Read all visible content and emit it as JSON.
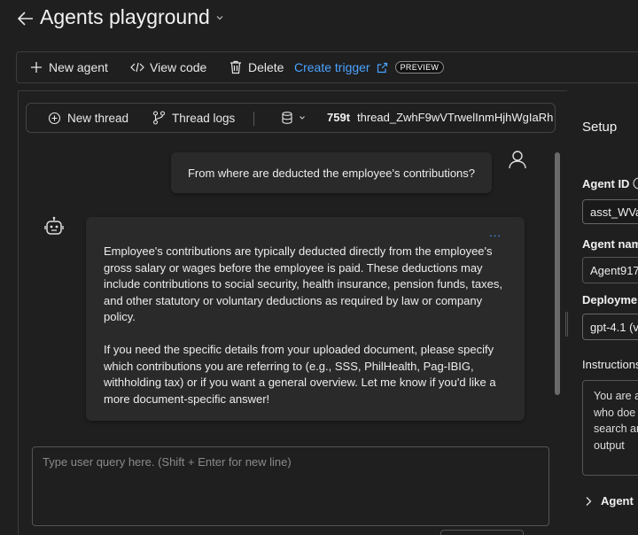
{
  "header": {
    "title": "Agents playground"
  },
  "toolbar": {
    "new_agent": "New agent",
    "view_code": "View code",
    "delete": "Delete",
    "create_trigger": "Create trigger",
    "preview_badge": "PREVIEW"
  },
  "thread_bar": {
    "new_thread": "New thread",
    "thread_logs": "Thread logs",
    "token_count": "759t",
    "thread_id": "thread_ZwhF9wVTrwelInmHjhWgIaRh"
  },
  "chat": {
    "user_message": "From where are deducted the employee's contributions?",
    "agent_message_p1": "Employee's contributions are typically deducted directly from the employee's gross salary or wages before the employee is paid. These deductions may include contributions to social security, health insurance, pension funds, taxes, and other statutory or voluntary deductions as required by law or company policy.",
    "agent_message_p2": "If you need the specific details from your uploaded document, please specify which contributions you are referring to (e.g., SSS, PhilHealth, Pag-IBIG, withholding tax) or if you want a general overview. Let me know if you'd like a more document-specific answer!",
    "more_menu": "...",
    "input_placeholder": "Type user query here. (Shift + Enter for new line)"
  },
  "setup": {
    "title": "Setup",
    "agent_id_label": "Agent ID",
    "agent_id_value": "asst_WVa",
    "agent_name_label": "Agent nam",
    "agent_name_value": "Agent917",
    "deployment_label": "Deploymen",
    "deployment_value": "gpt-4.1 (v",
    "instructions_label": "Instructions",
    "instructions_value": "You are a\nwho doe\nsearch ar\noutput",
    "agent_section": "Agent"
  },
  "colors": {
    "accent_link": "#4aa3ff",
    "background": "#1f1f1f",
    "bubble": "#2a2a2a"
  }
}
